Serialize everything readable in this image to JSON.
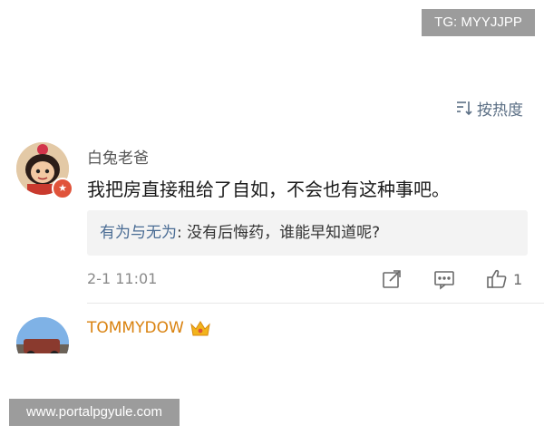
{
  "tg_badge": "TG: MYYJJPP",
  "sort": {
    "label": "按热度"
  },
  "comments": [
    {
      "username": "白兔老爸",
      "text": "我把房直接租给了自如，不会也有这种事吧。",
      "reply": {
        "name": "有为与无为",
        "sep": ": ",
        "text": "没有后悔药，谁能早知道呢?"
      },
      "timestamp": "2-1 11:01",
      "likes": "1"
    },
    {
      "username": "TOMMYDOW"
    }
  ],
  "watermark": "www.portalpgyule.com",
  "colors": {
    "link": "#4a6c94",
    "vip_name": "#d9820f",
    "reply_bg": "#f3f3f3"
  }
}
